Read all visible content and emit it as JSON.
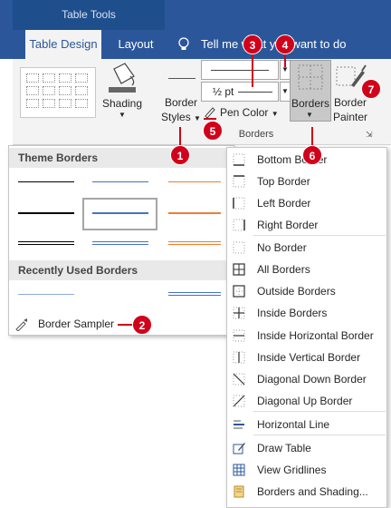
{
  "ribbon": {
    "context_label": "Table Tools",
    "tabs": [
      {
        "label": "Table Design",
        "active": true
      },
      {
        "label": "Layout",
        "active": false
      }
    ],
    "tell_me": "Tell me what you want to do",
    "shading_label": "Shading",
    "border_styles_label_1": "Border",
    "border_styles_label_2": "Styles",
    "pen_weight": "½ pt",
    "pen_color_label": "Pen Color",
    "borders_label": "Borders",
    "border_painter_label_1": "Border",
    "border_painter_label_2": "Painter",
    "group_label": "Borders"
  },
  "styles_panel": {
    "theme_header": "Theme Borders",
    "recent_header": "Recently Used Borders",
    "sampler_label": "Border Sampler",
    "colors": {
      "black": "#000000",
      "blue": "#4472c4",
      "orange": "#ed7d31"
    }
  },
  "borders_menu": {
    "items": [
      {
        "label": "Bottom Border",
        "icon": "bottom-border-icon"
      },
      {
        "label": "Top Border",
        "icon": "top-border-icon"
      },
      {
        "label": "Left Border",
        "icon": "left-border-icon"
      },
      {
        "label": "Right Border",
        "icon": "right-border-icon"
      },
      {
        "label": "No Border",
        "icon": "no-border-icon"
      },
      {
        "label": "All Borders",
        "icon": "all-borders-icon"
      },
      {
        "label": "Outside Borders",
        "icon": "outside-borders-icon"
      },
      {
        "label": "Inside Borders",
        "icon": "inside-borders-icon"
      },
      {
        "label": "Inside Horizontal Border",
        "icon": "inside-horizontal-border-icon"
      },
      {
        "label": "Inside Vertical Border",
        "icon": "inside-vertical-border-icon"
      },
      {
        "label": "Diagonal Down Border",
        "icon": "diagonal-down-border-icon"
      },
      {
        "label": "Diagonal Up Border",
        "icon": "diagonal-up-border-icon"
      },
      {
        "label": "Horizontal Line",
        "icon": "horizontal-line-icon"
      },
      {
        "label": "Draw Table",
        "icon": "draw-table-icon"
      },
      {
        "label": "View Gridlines",
        "icon": "view-gridlines-icon"
      },
      {
        "label": "Borders and Shading...",
        "icon": "borders-and-shading-icon"
      }
    ]
  },
  "callouts": [
    "1",
    "2",
    "3",
    "4",
    "5",
    "6",
    "7"
  ],
  "accent_color": "#d0021b",
  "brand_color": "#2b579a"
}
